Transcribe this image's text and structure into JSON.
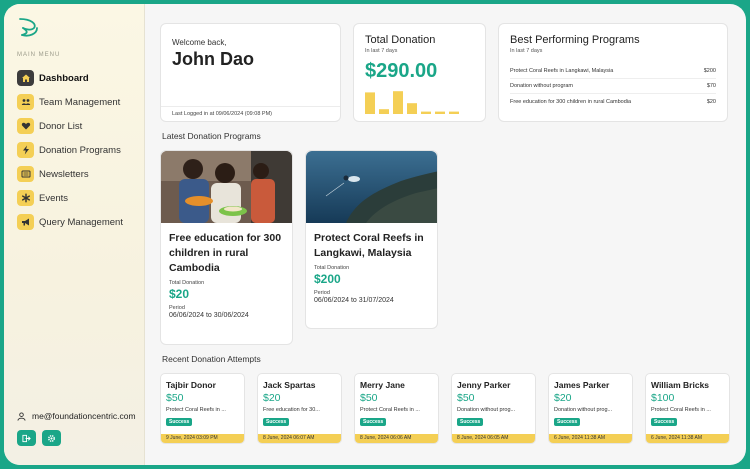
{
  "sidebar": {
    "menu_title": "MAIN MENU",
    "items": [
      {
        "label": "Dashboard",
        "icon": "home-icon",
        "active": true
      },
      {
        "label": "Team Management",
        "icon": "users-icon"
      },
      {
        "label": "Donor List",
        "icon": "heart-icon"
      },
      {
        "label": "Donation Programs",
        "icon": "bolt-icon"
      },
      {
        "label": "Newsletters",
        "icon": "newspaper-icon"
      },
      {
        "label": "Events",
        "icon": "asterisk-icon"
      },
      {
        "label": "Query Management",
        "icon": "megaphone-icon"
      }
    ],
    "user_email": "me@foundationcentric.com"
  },
  "welcome": {
    "greeting": "Welcome back,",
    "name": "John Dao",
    "last_login": "Last Logged in at 09/06/2024 (09:08 PM)"
  },
  "total_donation": {
    "title": "Total Donation",
    "subtitle": "In last 7 days",
    "amount": "$290.00",
    "bars": [
      0.9,
      0.2,
      0.95,
      0.45,
      0.1,
      0.1,
      0.1
    ],
    "bar_color": "#f4cf55"
  },
  "best_programs": {
    "title": "Best Performing Programs",
    "subtitle": "In last 7 days",
    "rows": [
      {
        "name": "Protect Coral Reefs in Langkawi, Malaysia",
        "amount": "$200"
      },
      {
        "name": "Donation without program",
        "amount": "$70"
      },
      {
        "name": "Free education for 300 children in rural Cambodia",
        "amount": "$20"
      }
    ]
  },
  "latest_programs": {
    "title": "Latest Donation Programs",
    "cards": [
      {
        "name": "Free education for 300 children in rural Cambodia",
        "total_label": "Total Donation",
        "total": "$20",
        "period_label": "Period",
        "period": "06/06/2024 to 30/06/2024"
      },
      {
        "name": "Protect Coral Reefs in Langkawi, Malaysia",
        "total_label": "Total Donation",
        "total": "$200",
        "period_label": "Period",
        "period": "06/06/2024 to 31/07/2024"
      }
    ]
  },
  "recent_attempts": {
    "title": "Recent Donation Attempts",
    "items": [
      {
        "name": "Tajbir Donor",
        "amount": "$50",
        "program": "Protect Coral Reefs in ...",
        "status": "Success",
        "time": "9 June, 2024 03:09 PM"
      },
      {
        "name": "Jack Spartas",
        "amount": "$20",
        "program": "Free education for 30...",
        "status": "Success",
        "time": "8 June, 2024 06:07 AM"
      },
      {
        "name": "Merry Jane",
        "amount": "$50",
        "program": "Protect Coral Reefs in ...",
        "status": "Success",
        "time": "8 June, 2024 06:06 AM"
      },
      {
        "name": "Jenny Parker",
        "amount": "$50",
        "program": "Donation without prog...",
        "status": "Success",
        "time": "8 June, 2024 06:05 AM"
      },
      {
        "name": "James Parker",
        "amount": "$20",
        "program": "Donation without prog...",
        "status": "Success",
        "time": "6 June, 2024 11:38 AM"
      },
      {
        "name": "William Bricks",
        "amount": "$100",
        "program": "Protect Coral Reefs in ...",
        "status": "Success",
        "time": "6 June, 2024 11:38 AM"
      }
    ]
  },
  "colors": {
    "accent": "#1aa688",
    "highlight": "#f4cf55"
  }
}
